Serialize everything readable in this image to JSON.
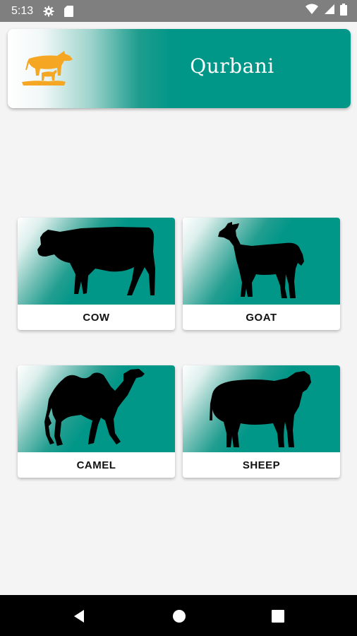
{
  "status_bar": {
    "time": "5:13",
    "icons": [
      "settings-icon",
      "sd-card-icon",
      "wifi-icon",
      "signal-icon",
      "battery-icon"
    ]
  },
  "header": {
    "title": "Qurbani",
    "logo_icon": "cow-and-calf-logo",
    "logo_color": "#f5a623"
  },
  "animals": [
    {
      "label": "COW",
      "icon": "cow-silhouette"
    },
    {
      "label": "GOAT",
      "icon": "goat-silhouette"
    },
    {
      "label": "CAMEL",
      "icon": "camel-silhouette"
    },
    {
      "label": "SHEEP",
      "icon": "sheep-silhouette"
    }
  ],
  "nav_bar": {
    "buttons": [
      "back-icon",
      "home-icon",
      "recents-icon"
    ]
  },
  "colors": {
    "accent": "#009688",
    "status_bar": "#7f7f7f",
    "background": "#f4f4f4"
  }
}
